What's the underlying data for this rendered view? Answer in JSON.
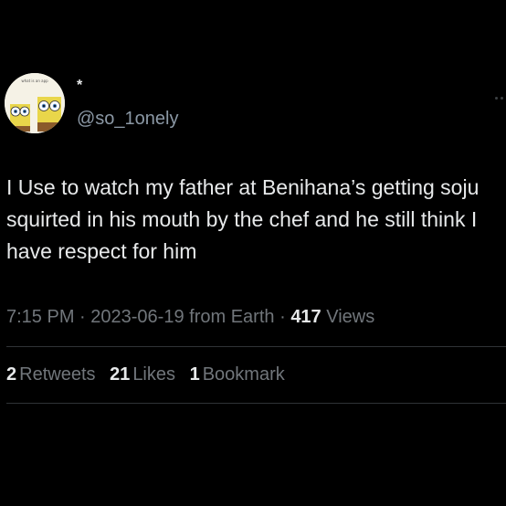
{
  "author": {
    "display_name": "*",
    "handle": "@so_1onely",
    "avatar_caption": "what is an app"
  },
  "tweet": {
    "text": "I Use to watch my father at Benihana’s getting soju squirted in his mouth by the chef and he still think I have respect for him"
  },
  "meta": {
    "time": "7:15 PM",
    "separator": "·",
    "date": "2023-06-19",
    "source": "from Earth",
    "views_count": "417",
    "views_label": "Views"
  },
  "stats": {
    "retweets_count": "2",
    "retweets_label": "Retweets",
    "likes_count": "21",
    "likes_label": "Likes",
    "bookmarks_count": "1",
    "bookmarks_label": "Bookmark"
  },
  "colors": {
    "background": "#000000",
    "primary_text": "#e7e9ea",
    "secondary_text": "#71767b",
    "divider": "#2f3336"
  }
}
